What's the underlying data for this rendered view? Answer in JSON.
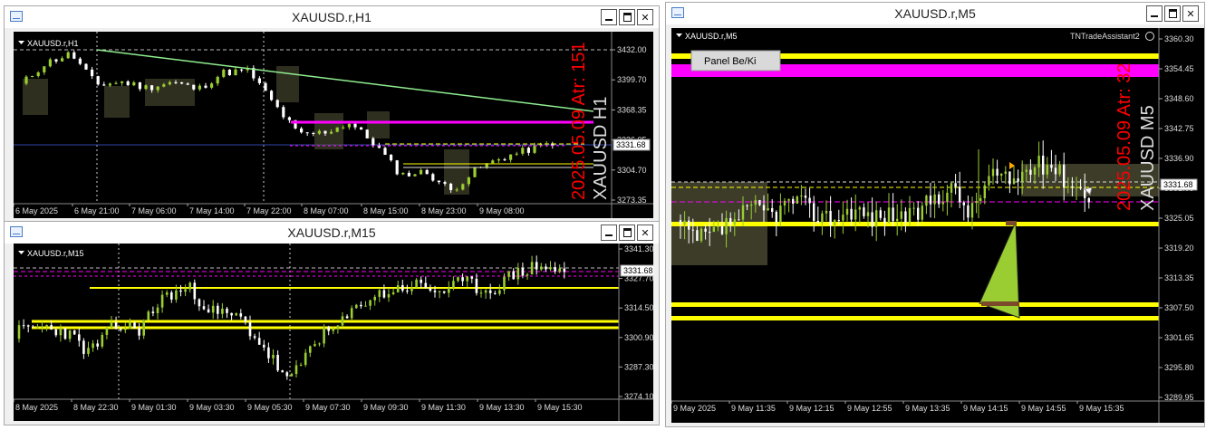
{
  "windows": {
    "h1": {
      "title": "XAUUSD.r,H1",
      "label": "XAUUSD.r,H1",
      "overlay": "2025.05.09 Atr: 151",
      "watermark": "XAUUSD H1",
      "price_tag": "3331.68",
      "y_ticks": [
        "3432.00",
        "3399.70",
        "3368.35",
        "3336.05",
        "3304.70",
        "3273.35"
      ],
      "x_ticks": [
        "6 May 2025",
        "6 May 21:00",
        "7 May 06:00",
        "7 May 14:00",
        "7 May 22:00",
        "8 May 07:00",
        "8 May 15:00",
        "8 May 23:00",
        "9 May 08:00"
      ]
    },
    "m15": {
      "title": "XAUUSD.r,M15",
      "label": "XAUUSD.r,M15",
      "price_tag": "3331.68",
      "y_ticks": [
        "3341.30",
        "3327.70",
        "3314.50",
        "3300.90",
        "3287.30",
        "3274.10"
      ],
      "x_ticks": [
        "8 May 2025",
        "8 May 22:30",
        "9 May 01:30",
        "9 May 03:30",
        "9 May 05:30",
        "9 May 07:30",
        "9 May 09:30",
        "9 May 11:30",
        "9 May 13:30",
        "9 May 15:30"
      ]
    },
    "m5": {
      "title": "XAUUSD.r,M5",
      "label": "XAUUSD.r,M5",
      "indicator": "TNTradeAssistant2",
      "button": "Panel Be/Ki",
      "overlay": "2025.05.09 Atr: 32",
      "watermark": "XAUUSD M5",
      "price_tag": "3331.68",
      "y_ticks": [
        "3360.30",
        "3354.45",
        "3348.60",
        "3342.75",
        "3336.90",
        "3331.05",
        "3325.05",
        "3319.20",
        "3313.35",
        "3307.50",
        "3301.65",
        "3295.80",
        "3289.95"
      ],
      "x_ticks": [
        "9 May 2025",
        "9 May 11:35",
        "9 May 12:15",
        "9 May 12:55",
        "9 May 13:35",
        "9 May 14:15",
        "9 May 14:55",
        "9 May 15:35"
      ]
    }
  },
  "icons": {
    "window": "chart-window-icon",
    "minimize": "minimize-icon",
    "maximize": "maximize-icon",
    "close": "close-icon",
    "dropdown": "triangle-down-icon",
    "smiley": "smiley-icon"
  },
  "colors": {
    "chart_bg": "#000000",
    "bull": "#9ACD32",
    "bear": "#FFFFFF",
    "support": "#FFFF00",
    "resistance": "#FF00FF",
    "trendline": "#90EE90",
    "overlay": "#FF0000"
  }
}
